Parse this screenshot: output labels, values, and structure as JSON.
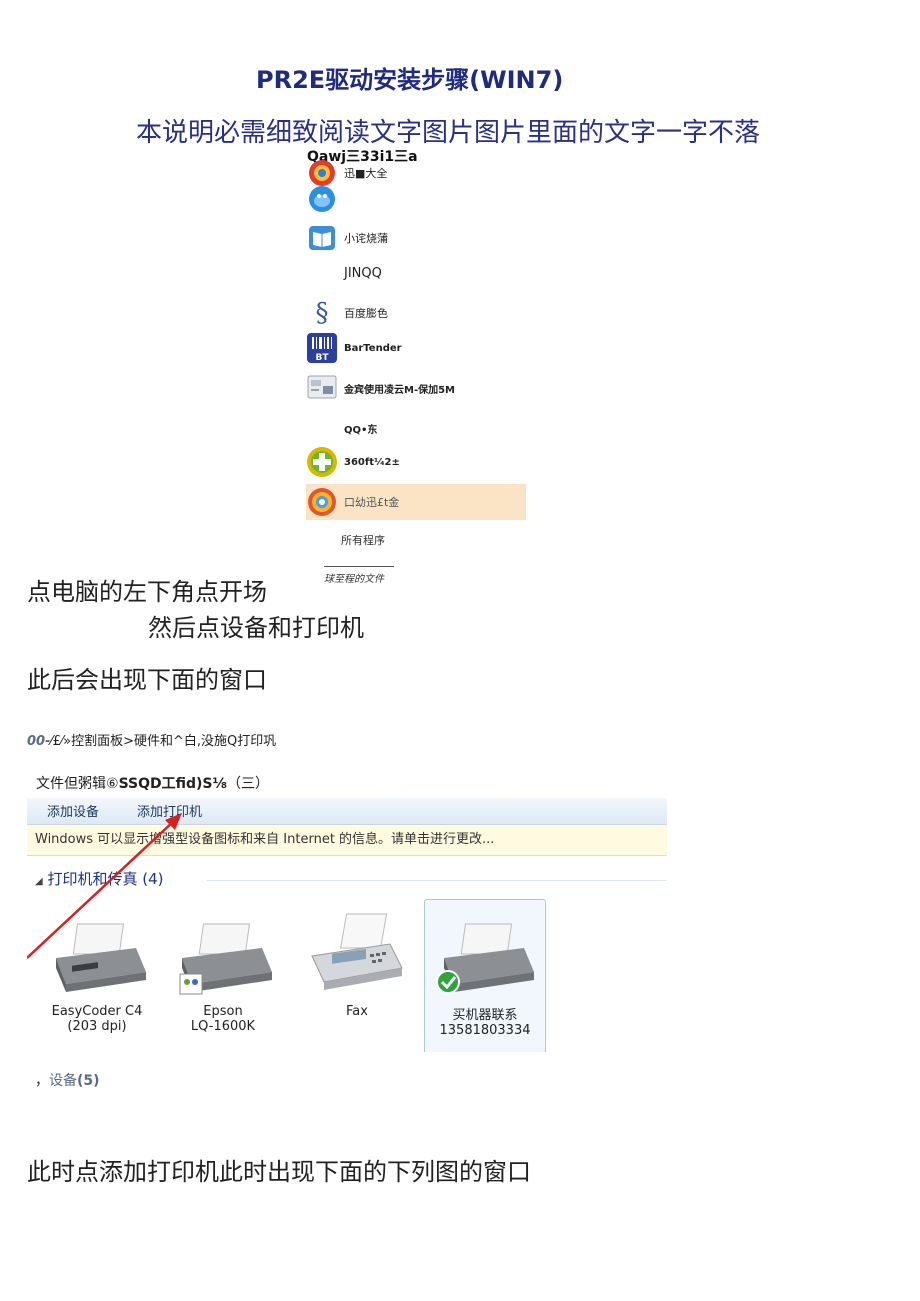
{
  "doc": {
    "title": "PR2E驱动安装步骤(WIN7)",
    "subtitle": "本说明必需细致阅读文字图片图片里面的文字一字不落",
    "step1_left": "点电脑的左下角点开场",
    "step1_right": "然后点设备和打印机",
    "step2": "此后会出现下面的窗口",
    "step3": "此时点添加打印机此时出现下面的下列图的窗口"
  },
  "start_menu": {
    "top_text": "Qawj三33i1三a",
    "items": [
      {
        "label": "迅■大全",
        "icon": "xunlei-icon"
      },
      {
        "label": "",
        "icon": "qq-penguin-icon"
      },
      {
        "label": "小诧烧蒲",
        "icon": "book-icon"
      },
      {
        "label": "JINQQ",
        "icon": ""
      },
      {
        "label": "百度膨色",
        "icon": "section-icon"
      },
      {
        "label": "BarTender",
        "icon": "bartender-icon"
      },
      {
        "label": "金宾使用凌云M-保加5M",
        "icon": "software-icon"
      },
      {
        "label": "QQ•东",
        "icon": ""
      },
      {
        "label": "360ft⅟₄2±",
        "icon": "plus-icon"
      },
      {
        "label": "口幼迅£t金",
        "icon": "browser-icon"
      }
    ],
    "all_programs": "所有程序",
    "recent_files": "球至程的文件"
  },
  "explorer": {
    "breadcrumb_nav": "00-",
    "breadcrumb_text": "⁄£⁄»控割面板>硬件和^白,没施Q打印巩",
    "menubar_plain": "文件但粥辑⑥",
    "menubar_bold": "SSQD工fid)S⅛",
    "menubar_tail": "（三）",
    "toolbar": {
      "add_device": "添加设备",
      "add_printer": "添加打印机"
    },
    "info_bar": "Windows 可以显示增强型设备图标和来自 Internet 的信息。请单击进行更改...",
    "group_label": "打印机和传真 (4)",
    "devices": [
      {
        "name": "EasyCoder C4",
        "sub": "(203 dpi)"
      },
      {
        "name": "Epson",
        "sub": "LQ-1600K"
      },
      {
        "name": "Fax",
        "sub": ""
      },
      {
        "name": "买机器联系",
        "sub": "13581803334"
      }
    ],
    "devices_prefix": "，",
    "devices_label": "设备",
    "devices_count": "(5)"
  }
}
